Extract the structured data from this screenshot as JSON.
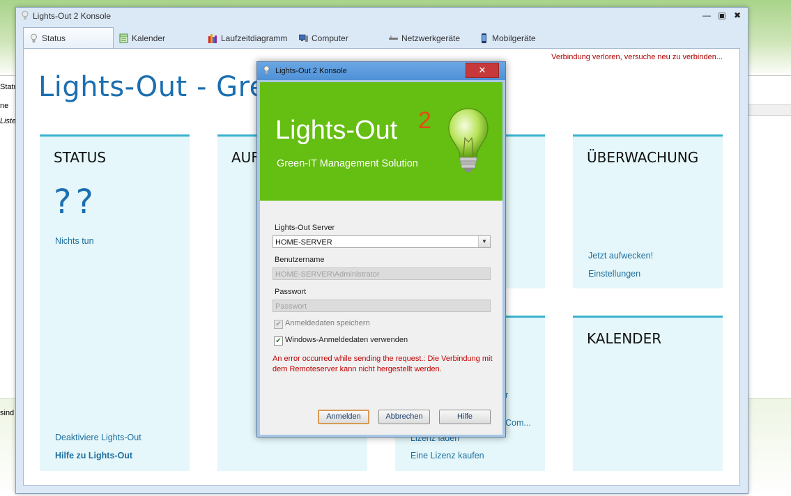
{
  "window": {
    "title": "Lights-Out 2 Konsole",
    "tabs": [
      {
        "label": "Status"
      },
      {
        "label": "Kalender"
      },
      {
        "label": "Laufzeitdiagramm"
      },
      {
        "label": "Computer"
      },
      {
        "label": "Netzwerkgeräte"
      },
      {
        "label": "Mobilgeräte"
      }
    ],
    "connection_status": "Verbindung verloren, versuche neu zu verbinden...",
    "page_title": "Lights-Out - Gree"
  },
  "background": {
    "labels": [
      "Statu",
      "ne",
      "Liste",
      "sind"
    ]
  },
  "tiles": {
    "status": {
      "heading": "STATUS",
      "value": "??",
      "action": "Nichts tun",
      "link_deactivate": "Deaktiviere Lights-Out",
      "link_help": "Hilfe zu Lights-Out"
    },
    "auf": {
      "heading": "AUF"
    },
    "ueberwachung": {
      "heading": "ÜBERWACHUNG",
      "link_wake": "Jetzt aufwecken!",
      "link_settings": "Einstellungen"
    },
    "kalender": {
      "heading": "KALENDER"
    },
    "license": {
      "partial_r": "r",
      "partial_com": "Com...",
      "link_load": "Lizenz laden",
      "link_buy": "Eine Lizenz kaufen"
    }
  },
  "dialog": {
    "title": "Lights-Out 2 Konsole",
    "close": "✕",
    "banner": {
      "product": "Lights-Out",
      "version": "2",
      "tagline": "Green-IT Management Solution"
    },
    "server_label": "Lights-Out Server",
    "server_value": "HOME-SERVER",
    "username_label": "Benutzername",
    "username_value": "HOME-SERVER\\Administrator",
    "password_label": "Passwort",
    "password_placeholder": "Passwort",
    "save_credentials": {
      "label": "Anmeldedaten speichern",
      "checked": true,
      "enabled": false
    },
    "windows_credentials": {
      "label": "Windows-Anmeldedaten verwenden",
      "checked": true,
      "enabled": true
    },
    "error_message": "An error occurred while sending the request.: Die Verbindung mit dem Remoteserver kann nicht hergestellt werden.",
    "buttons": {
      "login": "Anmelden",
      "cancel": "Abbrechen",
      "help": "Hilfe"
    }
  },
  "colors": {
    "accent_blue": "#1b6fb0",
    "tile_bg": "#e5f7fa",
    "tile_border": "#38b2cf",
    "banner_green": "#65be12",
    "error_red": "#c00000",
    "close_red": "#c7383a"
  }
}
